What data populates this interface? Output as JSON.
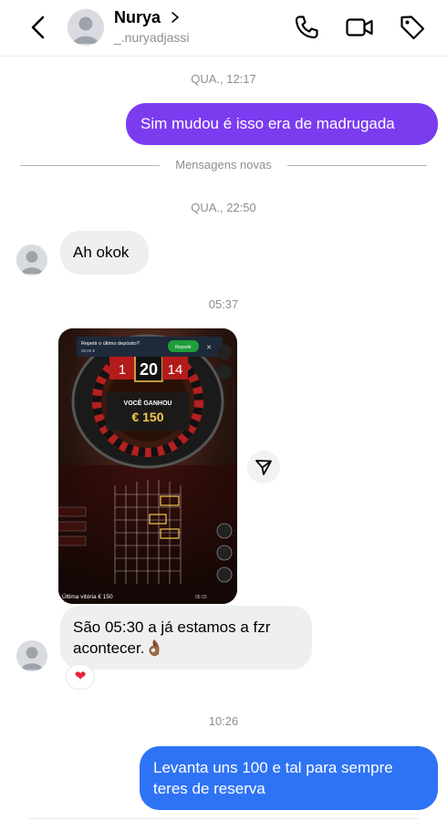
{
  "header": {
    "name": "Nurya",
    "handle": "_.nuryadjassi"
  },
  "conversation": {
    "stamp_1": "QUA., 12:17",
    "msg_1": "Sim mudou é isso era de madrugada",
    "divider_label": "Mensagens novas",
    "stamp_2": "QUA., 22:50",
    "msg_2": "Ah okok",
    "stamp_3": "05:37",
    "msg_3_line1": "São 05:30 a já estamos a fzr",
    "msg_3_line2": "acontecer.",
    "msg_3_emoji": "👌🏾",
    "reaction": "❤",
    "stamp_4": "10:26",
    "msg_4_line1": "Levanta uns 100 e tal para sempre",
    "msg_4_line2": "teres de reserva"
  },
  "attachment": {
    "banner_title": "Repetir o último depósito?",
    "banner_amount": "30,00 €",
    "banner_button": "Repetir",
    "banner_close": "✕",
    "numbers": [
      "1",
      "20",
      "14"
    ],
    "win_label": "VOCÊ GANHOU",
    "win_amount": "€ 150",
    "last_win": "Última vitória € 150",
    "clock": "05:33"
  },
  "colors": {
    "outgoing_purple": "#7b3cf0",
    "outgoing_blue": "#2f73f5",
    "incoming_bg": "#efefef",
    "timestamp": "#8e8e8e"
  }
}
